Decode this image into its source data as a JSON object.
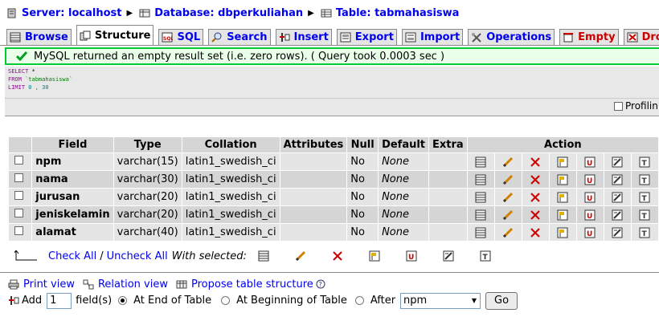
{
  "breadcrumb": {
    "server": "Server: localhost",
    "database": "Database: dbperkuliahan",
    "table": "Table: tabmahasiswa"
  },
  "tabs": [
    {
      "label": "Browse",
      "icon": "browse-icon"
    },
    {
      "label": "Structure",
      "icon": "structure-icon",
      "active": true
    },
    {
      "label": "SQL",
      "icon": "sql-icon"
    },
    {
      "label": "Search",
      "icon": "search-icon"
    },
    {
      "label": "Insert",
      "icon": "insert-icon"
    },
    {
      "label": "Export",
      "icon": "export-icon"
    },
    {
      "label": "Import",
      "icon": "import-icon"
    },
    {
      "label": "Operations",
      "icon": "operations-icon"
    },
    {
      "label": "Empty",
      "icon": "empty-icon"
    },
    {
      "label": "Drop",
      "icon": "drop-icon"
    }
  ],
  "notice": {
    "message": "MySQL returned an empty result set (i.e. zero rows). ( Query took 0.0003 sec )"
  },
  "sql": {
    "line1_kw": "SELECT",
    "line1_rest": " *",
    "line2_kw": "FROM",
    "line2_table": "`tabmahasiswa`",
    "line3_kw": "LIMIT",
    "line3_nums": "0 , 30",
    "profiling_label": "Profilin"
  },
  "table": {
    "headers": {
      "field": "Field",
      "type": "Type",
      "collation": "Collation",
      "attributes": "Attributes",
      "null": "Null",
      "default": "Default",
      "extra": "Extra",
      "action": "Action"
    },
    "rows": [
      {
        "field": "npm",
        "type": "varchar(15)",
        "collation": "latin1_swedish_ci",
        "attributes": "",
        "null": "No",
        "default": "None",
        "extra": ""
      },
      {
        "field": "nama",
        "type": "varchar(30)",
        "collation": "latin1_swedish_ci",
        "attributes": "",
        "null": "No",
        "default": "None",
        "extra": ""
      },
      {
        "field": "jurusan",
        "type": "varchar(20)",
        "collation": "latin1_swedish_ci",
        "attributes": "",
        "null": "No",
        "default": "None",
        "extra": ""
      },
      {
        "field": "jeniskelamin",
        "type": "varchar(20)",
        "collation": "latin1_swedish_ci",
        "attributes": "",
        "null": "No",
        "default": "None",
        "extra": ""
      },
      {
        "field": "alamat",
        "type": "varchar(40)",
        "collation": "latin1_swedish_ci",
        "attributes": "",
        "null": "No",
        "default": "None",
        "extra": ""
      }
    ],
    "action_icons": [
      "browse-distinct-icon",
      "change-icon",
      "drop-column-icon",
      "primary-key-icon",
      "unique-icon",
      "index-icon",
      "fulltext-icon"
    ]
  },
  "with_selected": {
    "check_all": "Check All",
    "slash": "/",
    "uncheck_all": "Uncheck All",
    "label": "With selected:"
  },
  "bottom_links": {
    "print_view": "Print view",
    "relation_view": "Relation view",
    "propose": "Propose table structure"
  },
  "add_fields": {
    "add_label": "Add",
    "count": "1",
    "fields_label": "field(s)",
    "at_end": "At End of Table",
    "at_beginning": "At Beginning of Table",
    "after": "After",
    "after_column": "npm",
    "go": "Go"
  }
}
